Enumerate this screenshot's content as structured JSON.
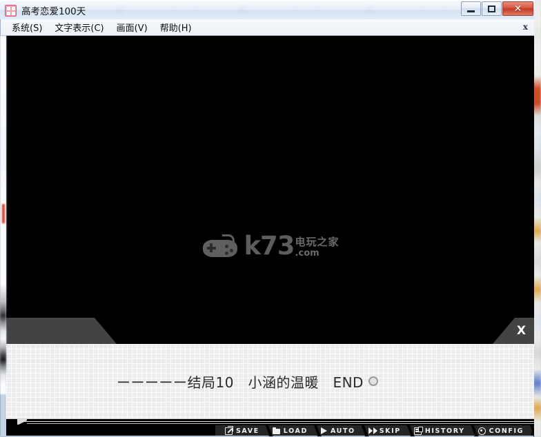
{
  "desktop": {
    "background_tabs": [
      {
        "title": "blurred-window-title-1"
      },
      {
        "title": "blurred-window-title-2"
      },
      {
        "title": "blurred-window-title-3"
      }
    ]
  },
  "window": {
    "title": "高考恋爱100天",
    "icon": "app-icon",
    "controls": {
      "minimize_label": "–",
      "maximize_label": "□",
      "close_label": "✕"
    },
    "accent_close_color": "#c23a26"
  },
  "menubar": {
    "items": [
      {
        "label": "系统(S)"
      },
      {
        "label": "文字表示(C)"
      },
      {
        "label": "画面(V)"
      },
      {
        "label": "帮助(H)"
      }
    ],
    "close_label": "x"
  },
  "game": {
    "background_color": "#000000",
    "watermark": {
      "brand": "k73",
      "brand_cn": "电玩之家",
      "domain": ".com",
      "icon": "gamepad-icon",
      "color": "#5d5d5d"
    },
    "nameplate": {
      "speaker": ""
    },
    "textbox": {
      "close_label": "X",
      "message": "ーーーーー结局10　小涵的温暖　END",
      "wait_marker": "circle-marker",
      "background_color": "#ececec",
      "text_color": "#2a2a2a"
    }
  },
  "command_bar": {
    "buttons": [
      {
        "label": "SAVE",
        "icon": "save-icon"
      },
      {
        "label": "LOAD",
        "icon": "folder-icon"
      },
      {
        "label": "AUTO",
        "icon": "play-icon"
      },
      {
        "label": "SKIP",
        "icon": "fast-forward-icon"
      },
      {
        "label": "HISTORY",
        "icon": "history-book-icon"
      },
      {
        "label": "CONFIG",
        "icon": "gear-icon"
      }
    ]
  }
}
